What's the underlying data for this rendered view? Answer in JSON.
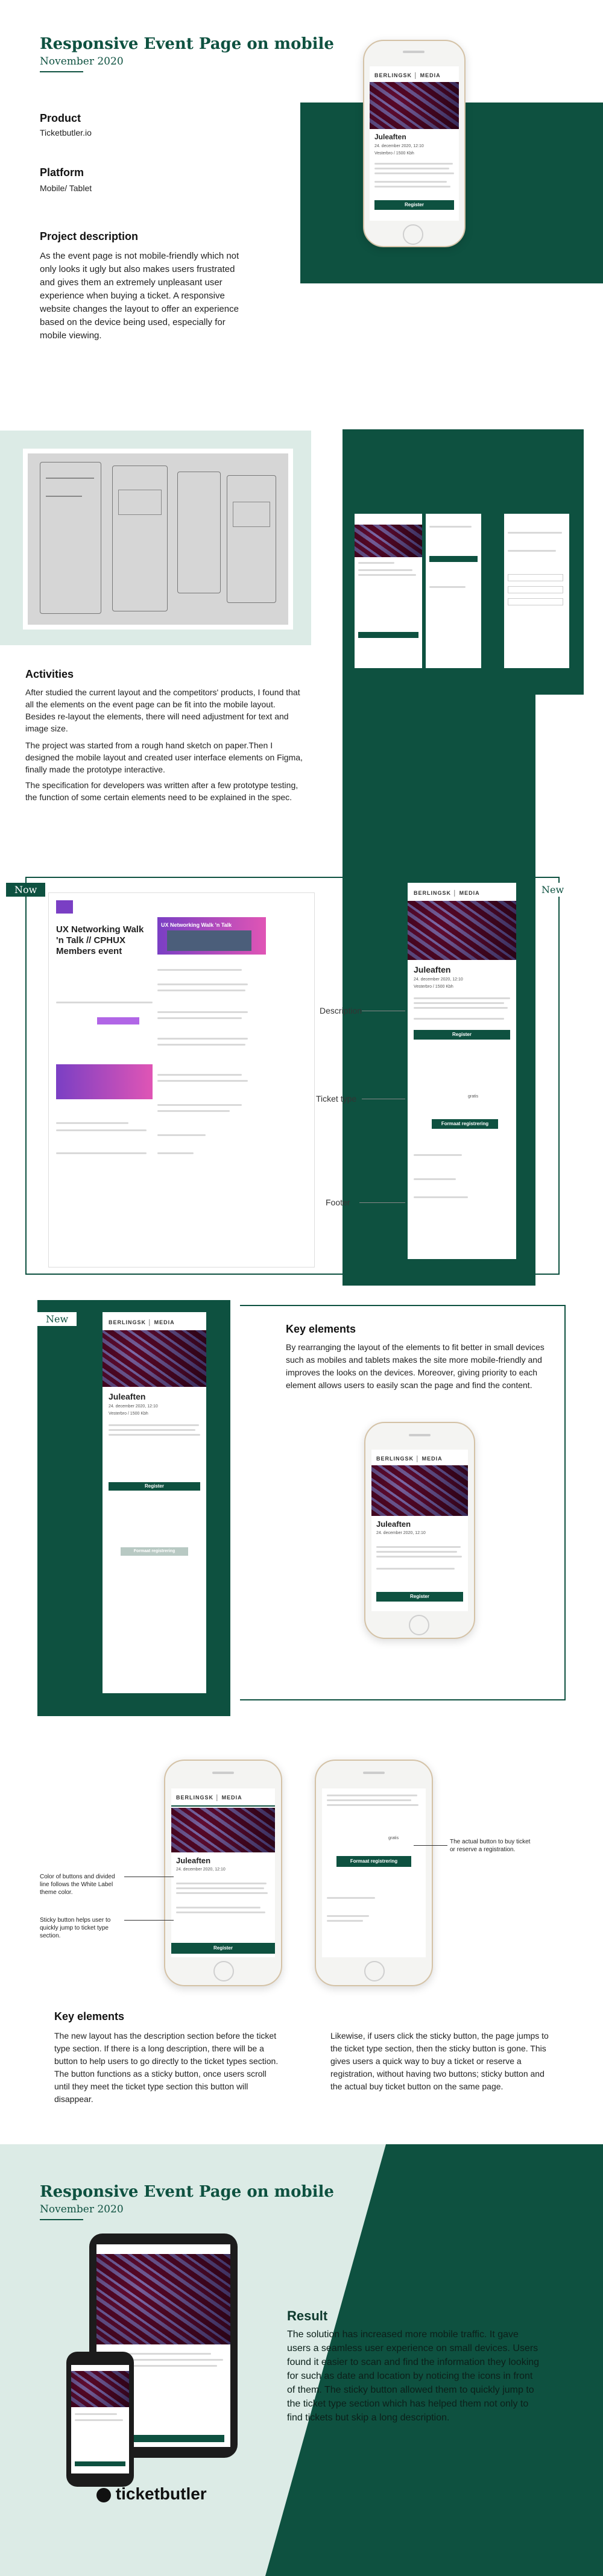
{
  "header": {
    "title": "Responsive Event Page on mobile",
    "date": "November 2020"
  },
  "product": {
    "label": "Product",
    "value": "Ticketbutler.io"
  },
  "platform": {
    "label": "Platform",
    "value": "Mobile/ Tablet"
  },
  "description": {
    "label": "Project description",
    "text": "As the event page is not mobile-friendly which not only looks it ugly but also makes users frustrated and gives them an extremely unpleasant user experience when buying a ticket. A responsive website changes the layout to offer an experience based on the device being used, especially for mobile viewing."
  },
  "event": {
    "brand": "BERLINGSK │ MEDIA",
    "name": "Juleaften",
    "date_line": "24. december 2020, 12:10",
    "venue_line": "Vesterbro / 1500 Kbh",
    "register_label": "Register",
    "formaat_label": "Formaat registrering",
    "price_label": "gratis",
    "nav_title": "UX Networking Walk 'n Talk"
  },
  "activities": {
    "title": "Activities",
    "p1": "After studied the current layout and the competitors' products, I found that all the elements on the event page can be fit into the mobile layout. Besides re-layout the elements, there will need adjustment for text and image size.",
    "p2": "The project was started from a rough hand sketch on paper.Then I designed the mobile layout and created user interface elements on Figma, finally made the prototype interactive.",
    "p3": "The specification for developers was written after a few prototype testing, the function of some certain elements need to be explained in the spec."
  },
  "compare": {
    "now_tag": "Now",
    "new_tag": "New",
    "old_title": "UX Networking Walk 'n Talk // CPHUX Members event",
    "annotations": [
      "Description",
      "Ticket type",
      "Footer"
    ]
  },
  "key1": {
    "tag": "New",
    "title": "Key elements",
    "text": "By rearranging the layout of the elements to fit better in small devices such as mobiles and tablets makes the site more mobile-friendly and improves the looks on the devices. Moreover, giving priority to each element allows users to easily scan the page and find the content."
  },
  "key2": {
    "callout1": "Color of buttons and divided line follows the White Label theme color.",
    "callout2": "Sticky button helps user to quickly jump to ticket type section.",
    "callout3": "The actual button to buy ticket or reserve a registration.",
    "title": "Key elements",
    "text_left": "The new layout has the description section before the ticket type section. If there is a long description, there will be a button to help users to go directly to the ticket types section. The button functions as a sticky button, once users scroll until they meet the ticket type section this button will disappear.",
    "text_right": "Likewise, if users click the sticky button, the page jumps to the ticket type section, then the sticky button is gone. This gives users a quick way to buy a ticket or reserve a registration, without having two buttons; sticky button and the actual buy ticket button on the same page."
  },
  "result": {
    "title": "Responsive Event Page on mobile",
    "date": "November 2020",
    "heading": "Result",
    "text": "The solution has increased more mobile traffic. It gave users a seamless user experience on small devices. Users found it easier to scan and find the information they looking for such as date and location by noticing the icons in front of them. The sticky button allowed them to quickly jump to the ticket type section which has helped them not only to find tickets but skip a long description.",
    "brand": "ticketbutler"
  },
  "colors": {
    "accent": "#0e5140",
    "mint": "#dcebe6"
  }
}
